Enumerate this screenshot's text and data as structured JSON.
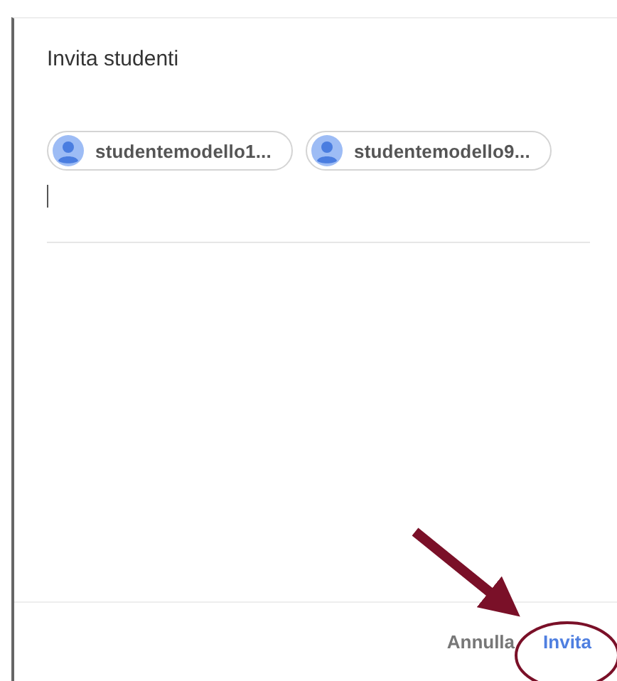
{
  "dialog": {
    "title": "Invita studenti"
  },
  "recipients": [
    {
      "name": "studentemodello1..."
    },
    {
      "name": "studentemodello9..."
    }
  ],
  "buttons": [
    {
      "label": "Annulla",
      "kind": "secondary"
    },
    {
      "label": "Invita",
      "kind": "primary"
    }
  ]
}
